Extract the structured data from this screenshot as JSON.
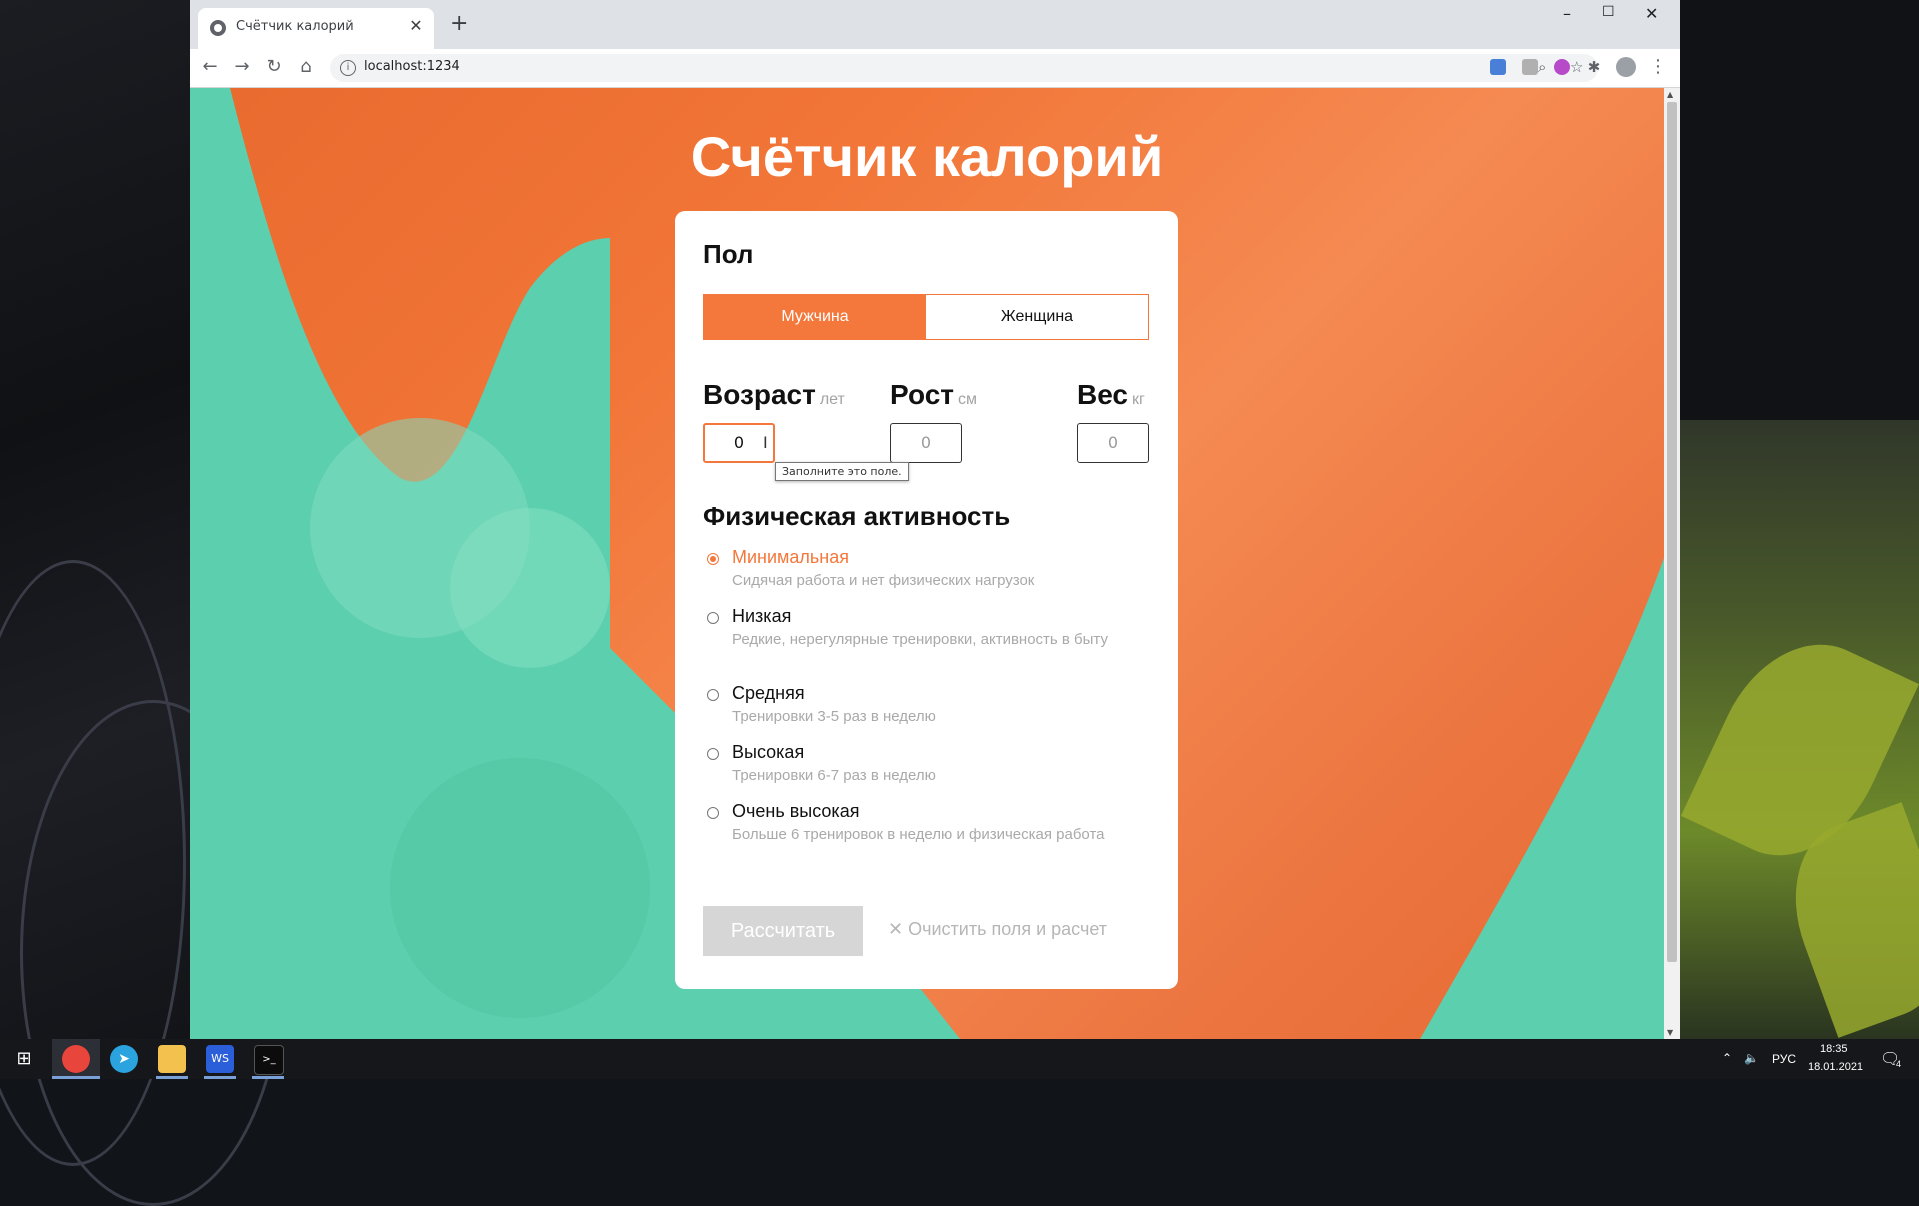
{
  "browser": {
    "tab_title": "Счётчик калорий",
    "url": "localhost:1234",
    "win_minimize": "–",
    "win_maximize": "☐",
    "win_close": "✕",
    "new_tab": "+"
  },
  "page": {
    "title": "Счётчик калорий",
    "gender": {
      "heading": "Пол",
      "options": [
        "Мужчина",
        "Женщина"
      ],
      "selected": "Мужчина"
    },
    "fields": [
      {
        "label": "Возраст",
        "unit": "лет",
        "value": "0"
      },
      {
        "label": "Рост",
        "unit": "см",
        "value": "0"
      },
      {
        "label": "Вес",
        "unit": "кг",
        "value": "0"
      }
    ],
    "tooltip": "Заполните это поле.",
    "activity": {
      "heading": "Физическая активность",
      "items": [
        {
          "title": "Минимальная",
          "desc": "Сидячая работа и нет физических нагрузок",
          "checked": true
        },
        {
          "title": "Низкая",
          "desc": "Редкие, нерегулярные тренировки, активность в быту",
          "checked": false
        },
        {
          "title": "Средняя",
          "desc": "Тренировки 3-5 раз в неделю",
          "checked": false
        },
        {
          "title": "Высокая",
          "desc": "Тренировки 6-7 раз в неделю",
          "checked": false
        },
        {
          "title": "Очень высокая",
          "desc": "Больше 6 тренировок в неделю и физическая работа",
          "checked": false
        }
      ]
    },
    "calc_button": "Рассчитать",
    "clear_button": "Очистить поля и расчет"
  },
  "taskbar": {
    "lang": "РУС",
    "time": "18:35",
    "date": "18.01.2021",
    "notifications": "4"
  },
  "colors": {
    "accent": "#f4773b",
    "teal": "#5ccfae",
    "disabled": "#d6d6d6"
  }
}
